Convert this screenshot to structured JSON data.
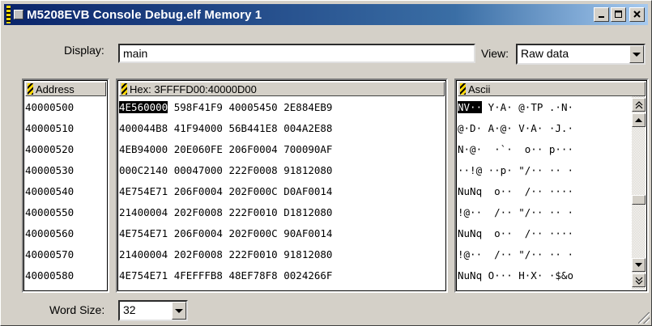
{
  "window": {
    "title": "M5208EVB Console Debug.elf Memory 1",
    "controls": [
      "minimize",
      "maximize",
      "close"
    ]
  },
  "display": {
    "label": "Display:",
    "value": "main"
  },
  "view": {
    "label": "View:",
    "value": "Raw data"
  },
  "word_size": {
    "label": "Word Size:",
    "value": "32"
  },
  "address_panel": {
    "header": "Address",
    "rows": [
      "40000500",
      "40000510",
      "40000520",
      "40000530",
      "40000540",
      "40000550",
      "40000560",
      "40000570",
      "40000580"
    ]
  },
  "hex_panel": {
    "header": "Hex: 3FFFFD00:40000D00",
    "rows": [
      [
        "4E560000",
        "598F41F9",
        "40005450",
        "2E884EB9"
      ],
      [
        "400044B8",
        "41F94000",
        "56B441E8",
        "004A2E88"
      ],
      [
        "4EB94000",
        "20E060FE",
        "206F0004",
        "700090AF"
      ],
      [
        "000C2140",
        "00047000",
        "222F0008",
        "91812080"
      ],
      [
        "4E754E71",
        "206F0004",
        "202F000C",
        "D0AF0014"
      ],
      [
        "21400004",
        "202F0008",
        "222F0010",
        "D1812080"
      ],
      [
        "4E754E71",
        "206F0004",
        "202F000C",
        "90AF0014"
      ],
      [
        "21400004",
        "202F0008",
        "222F0010",
        "91812080"
      ],
      [
        "4E754E71",
        "4FEFFFB8",
        "48EF78F8",
        "0024266F"
      ]
    ],
    "selected": "4E560000"
  },
  "ascii_panel": {
    "header": "Ascii",
    "rows": [
      {
        "sel": "NV··",
        "rest": " Y·A· @·TP .·N·"
      },
      {
        "sel": "",
        "rest": "@·D· A·@· V·A· ·J.·"
      },
      {
        "sel": "",
        "rest": "N·@·  ·`·  o·· p···"
      },
      {
        "sel": "",
        "rest": "··!@ ··p· \"/·· ·· ·"
      },
      {
        "sel": "",
        "rest": "NuNq  o··  /·· ····"
      },
      {
        "sel": "",
        "rest": "!@··  /·· \"/·· ·· ·"
      },
      {
        "sel": "",
        "rest": "NuNq  o··  /·· ····"
      },
      {
        "sel": "",
        "rest": "!@··  /·· \"/·· ·· ·"
      },
      {
        "sel": "",
        "rest": "NuNq O··· H·X· ·$&o"
      }
    ]
  }
}
